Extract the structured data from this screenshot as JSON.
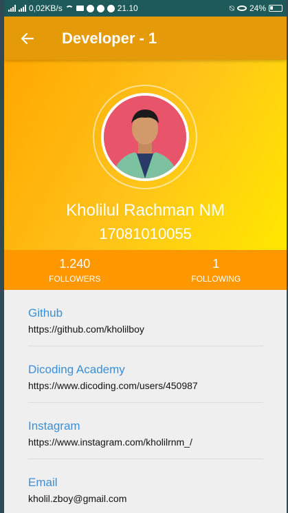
{
  "status_bar": {
    "net_speed": "0,02KB/s",
    "time": "21.10",
    "battery": "24%"
  },
  "appbar": {
    "back_icon": "arrow-left-icon",
    "title": "Developer - 1"
  },
  "profile": {
    "name": "Kholilul Rachman NM",
    "id": "17081010055"
  },
  "stats": {
    "followers_count": "1.240",
    "followers_label": "FOLLOWERS",
    "following_count": "1",
    "following_label": "FOLLOWING"
  },
  "links": [
    {
      "title": "Github",
      "value": "https://github.com/kholilboy"
    },
    {
      "title": "Dicoding Academy",
      "value": "https://www.dicoding.com/users/450987"
    },
    {
      "title": "Instagram",
      "value": "https://www.instagram.com/kholilrnm_/"
    },
    {
      "title": "Email",
      "value": "kholil.zboy@gmail.com"
    }
  ],
  "colors": {
    "appbar": "#e59a0a",
    "stats_bar": "#ff9800",
    "link_title": "#3a8fd6"
  }
}
